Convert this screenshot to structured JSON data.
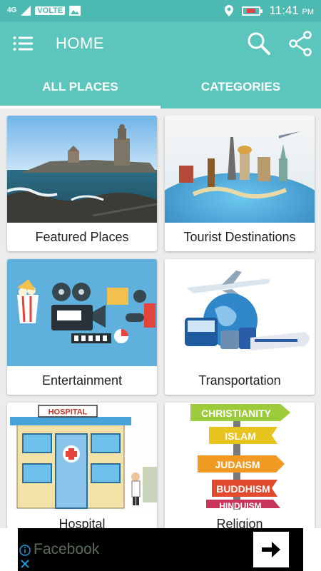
{
  "status_bar": {
    "network": "4G",
    "volte": "VOLTE",
    "time": "11:41",
    "ampm": "PM"
  },
  "app_bar": {
    "title": "HOME",
    "menu_icon": "list-menu-icon",
    "search_icon": "search-icon",
    "share_icon": "share-icon"
  },
  "tabs": [
    {
      "label": "ALL PLACES",
      "active": true
    },
    {
      "label": "CATEGORIES",
      "active": false
    }
  ],
  "cards": [
    {
      "label": "Featured Places",
      "image": "coastal-monument-photo"
    },
    {
      "label": "Tourist Destinations",
      "image": "world-landmarks-globe-illustration"
    },
    {
      "label": "Entertainment",
      "image": "cinema-icons-illustration"
    },
    {
      "label": "Transportation",
      "image": "plane-globe-train-illustration"
    },
    {
      "label": "Hospital",
      "image": "hospital-building-illustration",
      "image_text": "HOSPITAL"
    },
    {
      "label": "Religion",
      "image": "religion-signpost-illustration",
      "signs": [
        "CHRISTIANITY",
        "ISLAM",
        "JUDAISM",
        "BUDDHISM",
        "HINDUISM"
      ]
    }
  ],
  "ad": {
    "text": "Facebook",
    "info_icon": "info-icon",
    "close_icon": "close-icon",
    "arrow_icon": "arrow-right-icon"
  },
  "colors": {
    "primary": "#5cc6bd",
    "status_bar": "#4cbab0",
    "background": "#ececec"
  }
}
